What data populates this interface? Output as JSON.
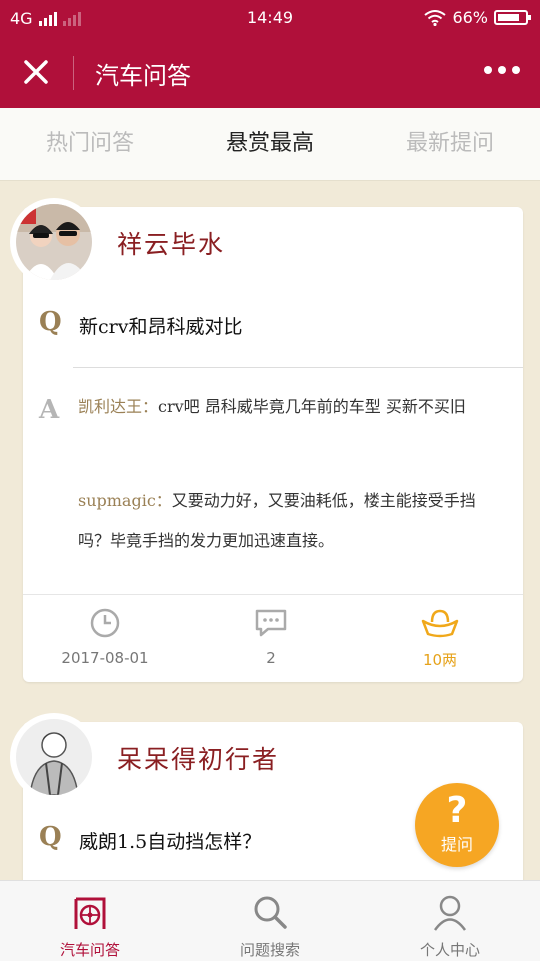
{
  "status_bar": {
    "network": "4G",
    "time": "14:49",
    "battery": "66%"
  },
  "header": {
    "title": "汽车问答"
  },
  "tabs": [
    {
      "label": "热门问答",
      "active": false
    },
    {
      "label": "悬赏最高",
      "active": true
    },
    {
      "label": "最新提问",
      "active": false
    }
  ],
  "posts": [
    {
      "username": "祥云毕水",
      "q_letter": "Q",
      "question": "新crv和昂科威对比",
      "a_letter": "A",
      "answers": [
        {
          "author": "凯利达王：",
          "text": "crv吧 昂科威毕竟几年前的车型 买新不买旧"
        },
        {
          "author": "supmagic：",
          "text": "又要动力好，又要油耗低，楼主能接受手挡吗？毕竟手挡的发力更加迅速直接。"
        }
      ],
      "date": "2017-08-01",
      "comments": "2",
      "reward": "10两"
    },
    {
      "username": "呆呆得初行者",
      "q_letter": "Q",
      "question": "威朗1.5自动挡怎样？"
    }
  ],
  "ask_button": {
    "symbol": "?",
    "label": "提问"
  },
  "bottom_nav": [
    {
      "label": "汽车问答",
      "icon": "wheel-icon",
      "active": true
    },
    {
      "label": "问题搜索",
      "icon": "search-icon",
      "active": false
    },
    {
      "label": "个人中心",
      "icon": "person-icon",
      "active": false
    }
  ],
  "colors": {
    "brand": "#b0103a",
    "accent": "#f6a623",
    "username": "#8a1f22",
    "answer_author": "#9a8055"
  }
}
